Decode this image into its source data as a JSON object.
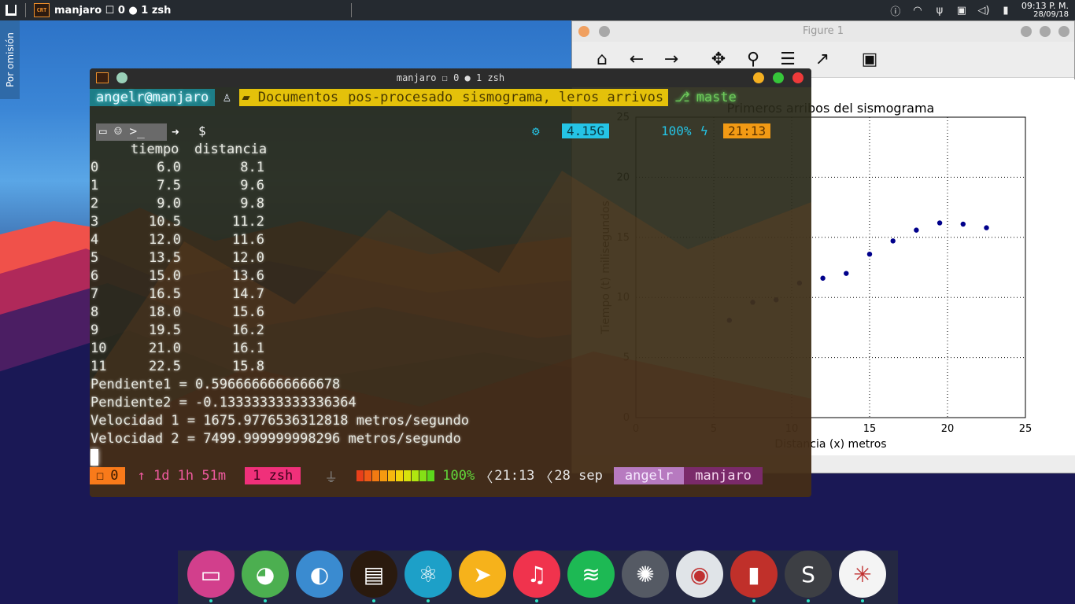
{
  "panel": {
    "task_label": "manjaro ☐ 0 ● 1 zsh",
    "crt_label": "CRT",
    "tray_icons": [
      "info-icon",
      "wifi-icon",
      "usb-icon",
      "clipboard-icon",
      "volume-icon",
      "battery-icon"
    ],
    "clock_time": "09:13 P. M.",
    "clock_date": "28/09/18"
  },
  "sidetab": {
    "label": "Por omisión"
  },
  "figure": {
    "title": "Figure 1",
    "toolbar": [
      "home-icon",
      "back-arrow-icon",
      "forward-arrow-icon",
      "move-icon",
      "zoom-icon",
      "subplots-icon",
      "line-chart-icon",
      "save-icon"
    ]
  },
  "chart_data": {
    "type": "scatter",
    "title": "Primeros arribos del sismograma",
    "xlabel": "Distancia (x) metros",
    "ylabel": "Tiempo (t) milisegundos",
    "xlim": [
      0,
      25
    ],
    "ylim": [
      0,
      25
    ],
    "xticks": [
      "0",
      "5",
      "10",
      "15",
      "20",
      "25"
    ],
    "yticks": [
      "0",
      "5",
      "10",
      "15",
      "20",
      "25"
    ],
    "grid": true,
    "color": "#00008b",
    "x": [
      6.0,
      7.5,
      9.0,
      10.5,
      12.0,
      13.5,
      15.0,
      16.5,
      18.0,
      19.5,
      21.0,
      22.5
    ],
    "y": [
      8.1,
      9.6,
      9.8,
      11.2,
      11.6,
      12.0,
      13.6,
      14.7,
      15.6,
      16.2,
      16.1,
      15.8
    ]
  },
  "terminal": {
    "title": "manjaro ☐ 0 ● 1 zsh",
    "user_host": "angelr@manjaro",
    "path": [
      "Documentos",
      "pos-procesado",
      "sismograma, leros arrivos"
    ],
    "git_branch": "maste",
    "prompt_symbol": "$",
    "status_line": {
      "memory": "4.15G",
      "battery": "100%",
      "time": "21:13"
    },
    "columns": [
      "tiempo",
      "distancia"
    ],
    "rows": [
      {
        "i": "0",
        "tiempo": "6.0",
        "distancia": "8.1"
      },
      {
        "i": "1",
        "tiempo": "7.5",
        "distancia": "9.6"
      },
      {
        "i": "2",
        "tiempo": "9.0",
        "distancia": "9.8"
      },
      {
        "i": "3",
        "tiempo": "10.5",
        "distancia": "11.2"
      },
      {
        "i": "4",
        "tiempo": "12.0",
        "distancia": "11.6"
      },
      {
        "i": "5",
        "tiempo": "13.5",
        "distancia": "12.0"
      },
      {
        "i": "6",
        "tiempo": "15.0",
        "distancia": "13.6"
      },
      {
        "i": "7",
        "tiempo": "16.5",
        "distancia": "14.7"
      },
      {
        "i": "8",
        "tiempo": "18.0",
        "distancia": "15.6"
      },
      {
        "i": "9",
        "tiempo": "19.5",
        "distancia": "16.2"
      },
      {
        "i": "10",
        "tiempo": "21.0",
        "distancia": "16.1"
      },
      {
        "i": "11",
        "tiempo": "22.5",
        "distancia": "15.8"
      }
    ],
    "output_lines": [
      "Pendiente1 = 0.5966666666666678",
      "Pendiente2 = -0.13333333333336364",
      "Velocidad 1 = 1675.9776536312818 metros/segundo",
      "Velocidad 2 = 7499.999999998296 metros/segundo"
    ],
    "bottom_bar": {
      "session": "0",
      "uptime": "↑ 1d 1h 51m",
      "shell": "1 zsh",
      "battery": "100%",
      "time": "21:13",
      "date": "28 sep",
      "user": "angelr",
      "host": "manjaro"
    }
  },
  "dock": {
    "items": [
      {
        "name": "files-icon",
        "color": "#d23f8c",
        "dot": true
      },
      {
        "name": "chromium-icon",
        "color": "#4caf50",
        "dot": true
      },
      {
        "name": "firefox-icon",
        "color": "#3a8bd0",
        "dot": false
      },
      {
        "name": "cool-retro-term-icon",
        "color": "#2a1a0e",
        "dot": true
      },
      {
        "name": "atom-icon",
        "color": "#1da0c8",
        "dot": true
      },
      {
        "name": "send-icon",
        "color": "#f6b21b",
        "dot": false
      },
      {
        "name": "music-icon",
        "color": "#f0334d",
        "dot": true
      },
      {
        "name": "spotify-icon",
        "color": "#1db954",
        "dot": false
      },
      {
        "name": "spider-icon",
        "color": "#555a64",
        "dot": false
      },
      {
        "name": "toggle-icon",
        "color": "#e0e4e8",
        "dot": false
      },
      {
        "name": "reader-icon",
        "color": "#c0302a",
        "dot": true
      },
      {
        "name": "sublime-icon",
        "color": "#3d3f44",
        "dot": true
      },
      {
        "name": "pinwheel-icon",
        "color": "#f4f4f4",
        "dot": true
      }
    ]
  }
}
